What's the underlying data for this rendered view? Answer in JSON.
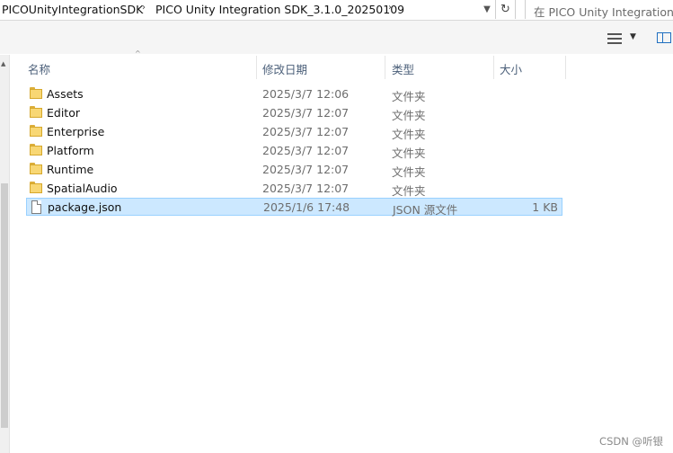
{
  "address": {
    "crumbs": [
      "PICOUnityIntegrationSDK",
      "PICO Unity Integration SDK_3.1.0_20250109"
    ],
    "separator": "›",
    "dropdown_icon": "chevron-down-icon",
    "refresh_icon": "refresh-icon"
  },
  "search": {
    "placeholder": "在 PICO Unity Integration S"
  },
  "toolbar": {
    "view_icon": "details-view-icon",
    "pane_icon": "preview-pane-icon"
  },
  "columns": {
    "name": "名称",
    "date": "修改日期",
    "type": "类型",
    "size": "大小"
  },
  "files": [
    {
      "name": "Assets",
      "date": "2025/3/7 12:06",
      "type": "文件夹",
      "size": "",
      "icon": "folder-icon"
    },
    {
      "name": "Editor",
      "date": "2025/3/7 12:07",
      "type": "文件夹",
      "size": "",
      "icon": "folder-icon"
    },
    {
      "name": "Enterprise",
      "date": "2025/3/7 12:07",
      "type": "文件夹",
      "size": "",
      "icon": "folder-icon"
    },
    {
      "name": "Platform",
      "date": "2025/3/7 12:07",
      "type": "文件夹",
      "size": "",
      "icon": "folder-icon"
    },
    {
      "name": "Runtime",
      "date": "2025/3/7 12:07",
      "type": "文件夹",
      "size": "",
      "icon": "folder-icon"
    },
    {
      "name": "SpatialAudio",
      "date": "2025/3/7 12:07",
      "type": "文件夹",
      "size": "",
      "icon": "folder-icon"
    },
    {
      "name": "package.json",
      "date": "2025/1/6 17:48",
      "type": "JSON 源文件",
      "size": "1 KB",
      "icon": "file-icon",
      "selected": true
    }
  ],
  "watermark": "CSDN @听银",
  "colors": {
    "selection_bg": "#cce8ff",
    "selection_border": "#99d1ff",
    "folder": "#f8d774",
    "header_text": "#4c607a"
  }
}
